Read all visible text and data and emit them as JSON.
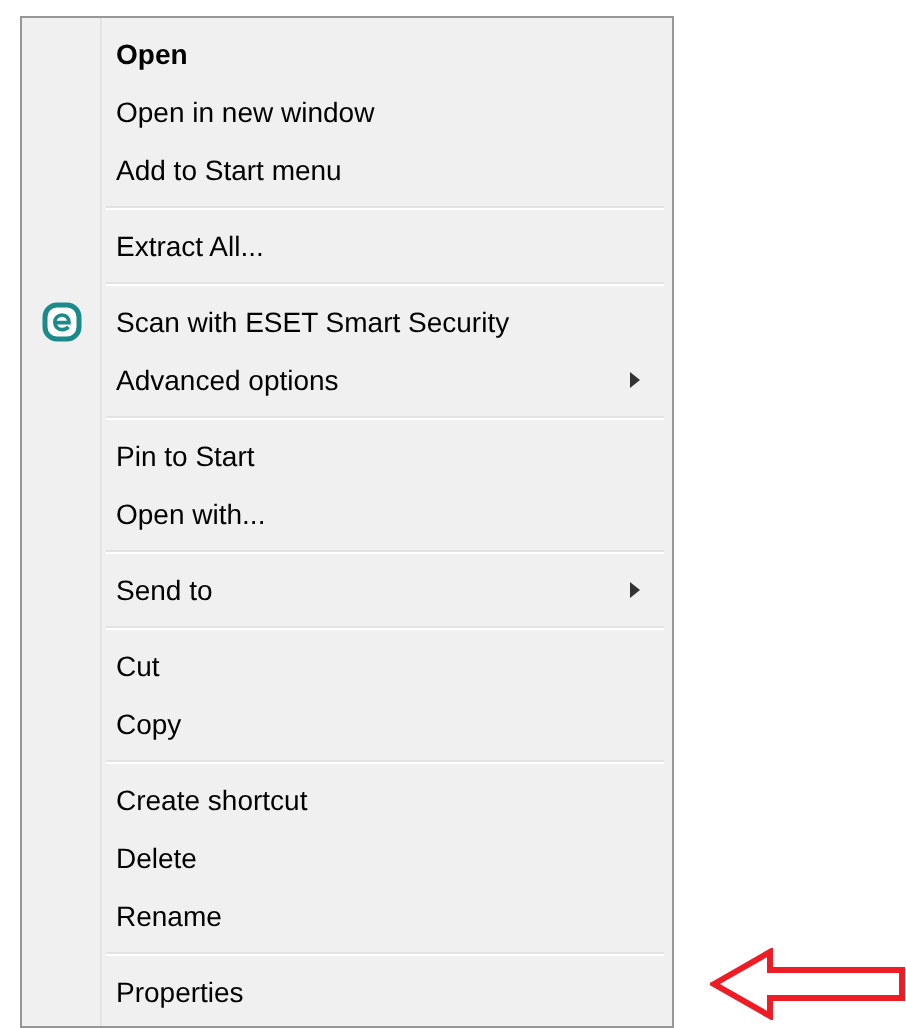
{
  "context_menu": {
    "groups": [
      {
        "items": [
          {
            "label": "Open",
            "bold": true,
            "submenu": false,
            "icon": false
          },
          {
            "label": "Open in new window",
            "bold": false,
            "submenu": false,
            "icon": false
          },
          {
            "label": "Add to Start menu",
            "bold": false,
            "submenu": false,
            "icon": false
          }
        ]
      },
      {
        "items": [
          {
            "label": "Extract All...",
            "bold": false,
            "submenu": false,
            "icon": false
          }
        ]
      },
      {
        "items": [
          {
            "label": "Scan with ESET Smart Security",
            "bold": false,
            "submenu": false,
            "icon": true
          },
          {
            "label": "Advanced options",
            "bold": false,
            "submenu": true,
            "icon": false
          }
        ]
      },
      {
        "items": [
          {
            "label": "Pin to Start",
            "bold": false,
            "submenu": false,
            "icon": false
          },
          {
            "label": "Open with...",
            "bold": false,
            "submenu": false,
            "icon": false
          }
        ]
      },
      {
        "items": [
          {
            "label": "Send to",
            "bold": false,
            "submenu": true,
            "icon": false
          }
        ]
      },
      {
        "items": [
          {
            "label": "Cut",
            "bold": false,
            "submenu": false,
            "icon": false
          },
          {
            "label": "Copy",
            "bold": false,
            "submenu": false,
            "icon": false
          }
        ]
      },
      {
        "items": [
          {
            "label": "Create shortcut",
            "bold": false,
            "submenu": false,
            "icon": false
          },
          {
            "label": "Delete",
            "bold": false,
            "submenu": false,
            "icon": false
          },
          {
            "label": "Rename",
            "bold": false,
            "submenu": false,
            "icon": false
          }
        ]
      },
      {
        "items": [
          {
            "label": "Properties",
            "bold": false,
            "submenu": false,
            "icon": false
          }
        ]
      }
    ]
  }
}
